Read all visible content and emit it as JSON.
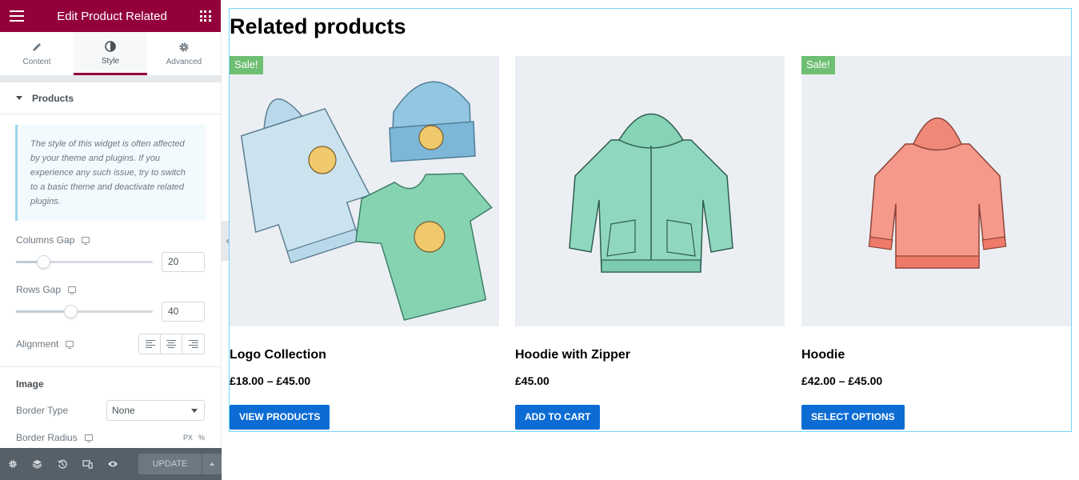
{
  "panel": {
    "title": "Edit Product Related",
    "tabs": [
      {
        "label": "Content",
        "icon": "pencil-icon"
      },
      {
        "label": "Style",
        "icon": "half-circle-icon"
      },
      {
        "label": "Advanced",
        "icon": "gear-icon"
      }
    ],
    "section_title": "Products",
    "notice": "The style of this widget is often affected by your theme and plugins. If you experience any such issue, try to switch to a basic theme and deactivate related plugins.",
    "columns_gap": {
      "label": "Columns Gap",
      "value": "20",
      "fraction": 0.2
    },
    "rows_gap": {
      "label": "Rows Gap",
      "value": "40",
      "fraction": 0.4
    },
    "alignment": {
      "label": "Alignment"
    },
    "image_heading": "Image",
    "border_type": {
      "label": "Border Type",
      "value": "None"
    },
    "border_radius": {
      "label": "Border Radius",
      "unit_px": "PX",
      "unit_pct": "%"
    },
    "footer": {
      "update_label": "UPDATE"
    }
  },
  "preview": {
    "title": "Related products",
    "products": [
      {
        "name": "Logo Collection",
        "price": "£18.00 – £45.00",
        "button": "VIEW PRODUCTS",
        "sale": "Sale!"
      },
      {
        "name": "Hoodie with Zipper",
        "price": "£45.00",
        "button": "ADD TO CART",
        "sale": ""
      },
      {
        "name": "Hoodie",
        "price": "£42.00 – £45.00",
        "button": "SELECT OPTIONS",
        "sale": "Sale!"
      }
    ]
  },
  "colors": {
    "brand": "#93003c",
    "button": "#0c6cd4",
    "sale_badge": "#6fbf73",
    "widget_outline": "#71d7f7"
  }
}
